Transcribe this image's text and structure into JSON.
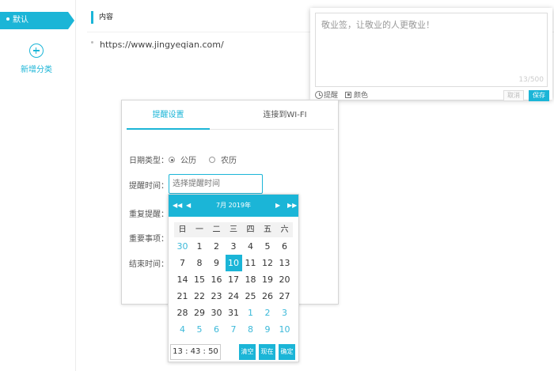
{
  "sidebar": {
    "default_category": "默认",
    "add_category": "新增分类"
  },
  "content": {
    "header": "内容",
    "url": "https://www.jingyeqian.com/"
  },
  "note": {
    "placeholder": "敬业签，让敬业的人更敬业！",
    "counter": "13/500",
    "reminder_label": "提醒",
    "color_label": "颜色",
    "cancel": "取消",
    "save": "保存"
  },
  "dialog": {
    "tabs": [
      "提醒设置",
      "连接到WI-FI"
    ],
    "date_type_label": "日期类型：",
    "date_type_options": [
      "公历",
      "农历"
    ],
    "date_type_selected": "公历",
    "remind_time_label": "提醒时间：",
    "remind_time_placeholder": "选择提醒时间",
    "repeat_label": "重复提醒：",
    "important_label": "重要事项：",
    "end_time_label": "结束时间："
  },
  "datepicker": {
    "title": "7月 2019年",
    "weekdays": [
      "日",
      "一",
      "二",
      "三",
      "四",
      "五",
      "六"
    ],
    "days": [
      [
        "30",
        "1",
        "2",
        "3",
        "4",
        "5",
        "6"
      ],
      [
        "7",
        "8",
        "9",
        "10",
        "11",
        "12",
        "13"
      ],
      [
        "14",
        "15",
        "16",
        "17",
        "18",
        "19",
        "20"
      ],
      [
        "21",
        "22",
        "23",
        "24",
        "25",
        "26",
        "27"
      ],
      [
        "28",
        "29",
        "30",
        "31",
        "1",
        "2",
        "3"
      ],
      [
        "4",
        "5",
        "6",
        "7",
        "8",
        "9",
        "10"
      ]
    ],
    "selected_day": "10",
    "time": "13 : 43 : 50",
    "buttons": [
      "清空",
      "现在",
      "确定"
    ]
  },
  "colors": {
    "accent": "#1bb5d7",
    "other_month_text": "#3cb9d9"
  }
}
